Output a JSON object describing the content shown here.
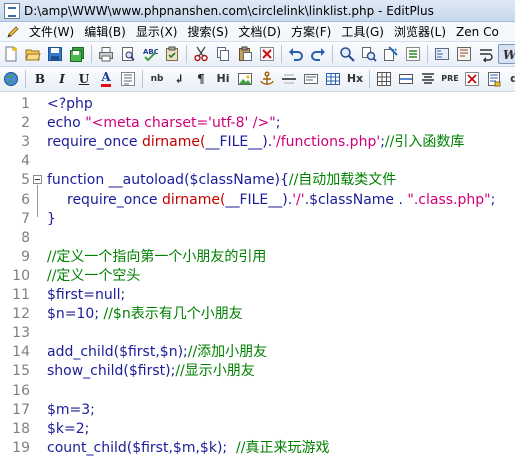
{
  "window": {
    "title": "D:\\amp\\WWW\\www.phpnanshen.com\\circlelink\\linklist.php - EditPlus"
  },
  "menu": {
    "items": [
      "文件(W)",
      "编辑(B)",
      "显示(X)",
      "搜索(S)",
      "文档(D)",
      "方案(F)",
      "工具(G)",
      "浏览器(L)",
      "Zen Co"
    ]
  },
  "toolbar_html": {
    "bold": "B",
    "italic": "I",
    "underline": "U",
    "font_color": "A",
    "nbsp": "nb",
    "line_break": "↲",
    "paragraph": "¶",
    "heading": "Hi",
    "heading_x": "Hx",
    "pre": "PRE",
    "div": "di"
  },
  "editor": {
    "lines": [
      {
        "n": "1",
        "segments": [
          {
            "t": "<?php",
            "c": "blk"
          }
        ]
      },
      {
        "n": "2",
        "segments": [
          {
            "t": "echo ",
            "c": "plain"
          },
          {
            "t": "\"<meta charset='utf-8' />\"",
            "c": "str"
          },
          {
            "t": ";",
            "c": "plain"
          }
        ]
      },
      {
        "n": "3",
        "segments": [
          {
            "t": "require_once ",
            "c": "plain"
          },
          {
            "t": "dirname(",
            "c": "fn"
          },
          {
            "t": "__FILE__",
            "c": "plain"
          },
          {
            "t": ").",
            "c": "plain"
          },
          {
            "t": "'/functions.php'",
            "c": "str"
          },
          {
            "t": ";",
            "c": "plain"
          },
          {
            "t": "//引入函数库",
            "c": "cmt"
          }
        ]
      },
      {
        "n": "4",
        "segments": []
      },
      {
        "n": "5",
        "fold": true,
        "segments": [
          {
            "t": "function ",
            "c": "plain"
          },
          {
            "t": "__autoload(",
            "c": "plain"
          },
          {
            "t": "$className",
            "c": "var"
          },
          {
            "t": "){",
            "c": "plain"
          },
          {
            "t": "//自动加载类文件",
            "c": "cmt"
          }
        ]
      },
      {
        "n": "6",
        "indent": true,
        "segments": [
          {
            "t": "require_once ",
            "c": "plain"
          },
          {
            "t": "dirname(",
            "c": "fn"
          },
          {
            "t": "__FILE__",
            "c": "plain"
          },
          {
            "t": ").",
            "c": "plain"
          },
          {
            "t": "'/'",
            "c": "str"
          },
          {
            "t": ".",
            "c": "plain"
          },
          {
            "t": "$className",
            "c": "var"
          },
          {
            "t": " . ",
            "c": "plain"
          },
          {
            "t": "\".class.php\"",
            "c": "str"
          },
          {
            "t": ";",
            "c": "plain"
          }
        ]
      },
      {
        "n": "7",
        "segments": [
          {
            "t": "}",
            "c": "plain"
          }
        ]
      },
      {
        "n": "8",
        "segments": []
      },
      {
        "n": "9",
        "segments": [
          {
            "t": "//定义一个指向第一个小朋友的引用",
            "c": "cmt"
          }
        ]
      },
      {
        "n": "10",
        "segments": [
          {
            "t": "//定义一个空头",
            "c": "cmt"
          }
        ]
      },
      {
        "n": "11",
        "segments": [
          {
            "t": "$first",
            "c": "var"
          },
          {
            "t": "=null;",
            "c": "plain"
          }
        ]
      },
      {
        "n": "12",
        "segments": [
          {
            "t": "$n",
            "c": "var"
          },
          {
            "t": "=10; ",
            "c": "plain"
          },
          {
            "t": "//$n表示有几个小朋友",
            "c": "cmt"
          }
        ]
      },
      {
        "n": "13",
        "segments": []
      },
      {
        "n": "14",
        "segments": [
          {
            "t": "add_child(",
            "c": "plain"
          },
          {
            "t": "$first",
            "c": "var"
          },
          {
            "t": ",",
            "c": "plain"
          },
          {
            "t": "$n",
            "c": "var"
          },
          {
            "t": ");",
            "c": "plain"
          },
          {
            "t": "//添加小朋友",
            "c": "cmt"
          }
        ]
      },
      {
        "n": "15",
        "segments": [
          {
            "t": "show_child(",
            "c": "plain"
          },
          {
            "t": "$first",
            "c": "var"
          },
          {
            "t": ");",
            "c": "plain"
          },
          {
            "t": "//显示小朋友",
            "c": "cmt"
          }
        ]
      },
      {
        "n": "16",
        "segments": []
      },
      {
        "n": "17",
        "segments": [
          {
            "t": "$m",
            "c": "var"
          },
          {
            "t": "=3;",
            "c": "plain"
          }
        ]
      },
      {
        "n": "18",
        "segments": [
          {
            "t": "$k",
            "c": "var"
          },
          {
            "t": "=2;",
            "c": "plain"
          }
        ]
      },
      {
        "n": "19",
        "segments": [
          {
            "t": "count_child(",
            "c": "plain"
          },
          {
            "t": "$first",
            "c": "var"
          },
          {
            "t": ",",
            "c": "plain"
          },
          {
            "t": "$m",
            "c": "var"
          },
          {
            "t": ",",
            "c": "plain"
          },
          {
            "t": "$k",
            "c": "var"
          },
          {
            "t": ");  ",
            "c": "plain"
          },
          {
            "t": "//真正来玩游戏",
            "c": "cmt"
          }
        ]
      }
    ]
  }
}
